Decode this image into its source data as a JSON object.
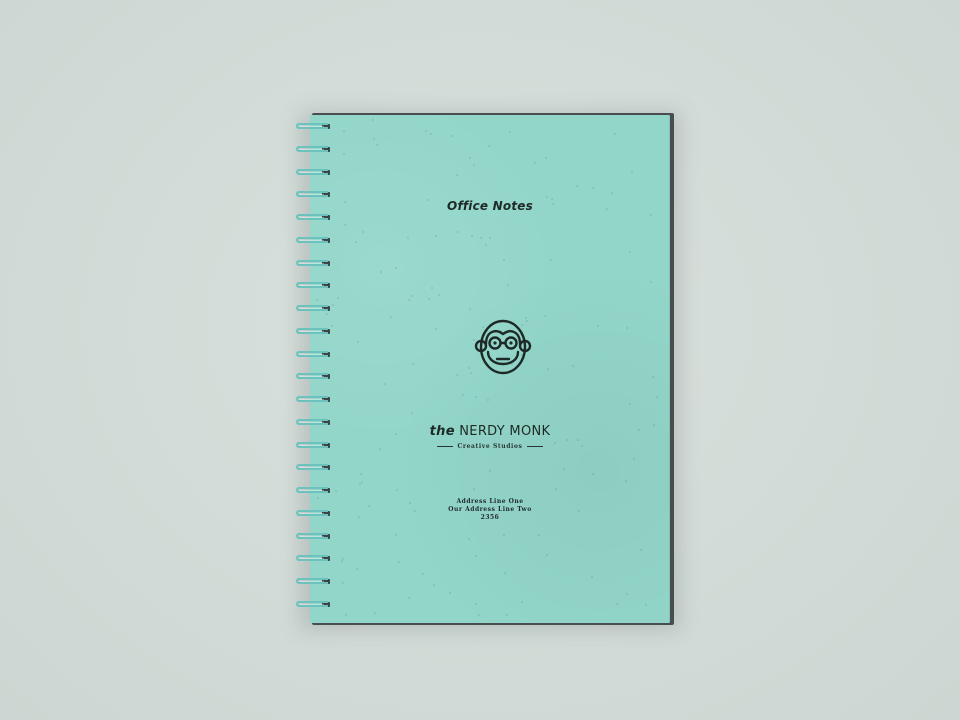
{
  "notebook": {
    "title": "Office Notes",
    "brand_prefix": "the",
    "brand_name": "NERDY MONK",
    "subtitle": "Creative Studios",
    "address_lines": [
      "Address Line One",
      "Our Address Line Two",
      "2356"
    ],
    "logo_icon": "monkey-face-with-glasses-icon",
    "colors": {
      "background": "#d3dcd8",
      "cover": "#92d6c9",
      "spiral": "#6cc2bc",
      "ink": "#1e2a28",
      "back_cover": "#4a4d50"
    },
    "spiral_ring_count": 22
  }
}
